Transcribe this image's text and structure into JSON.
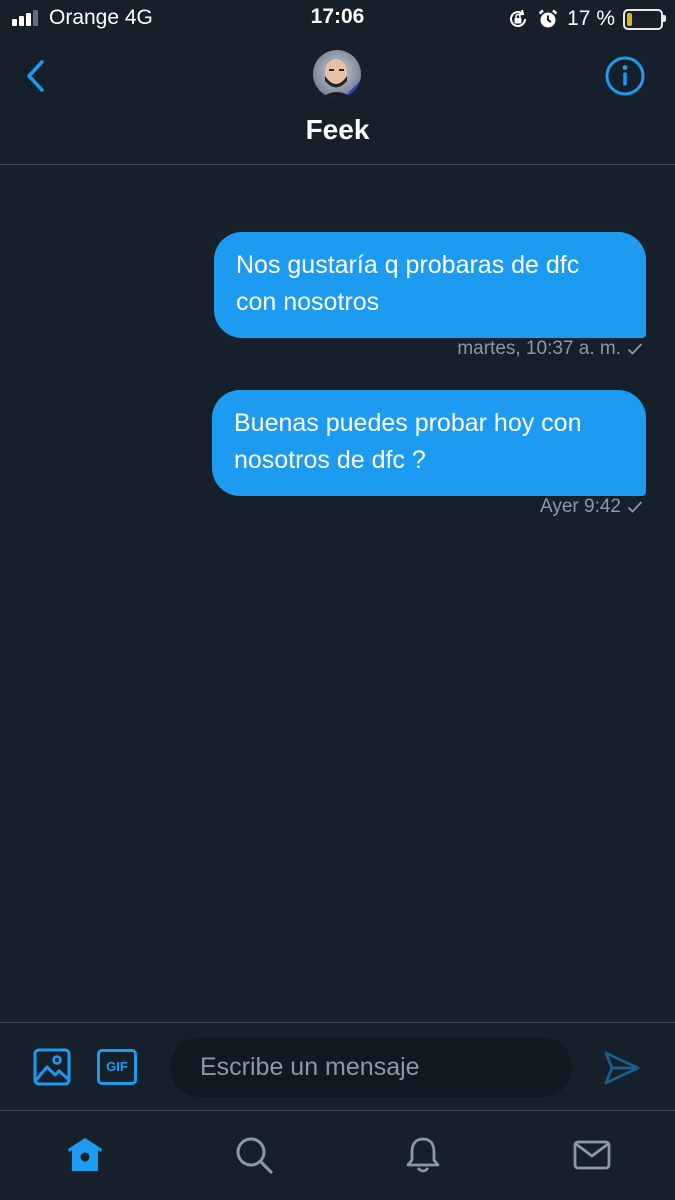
{
  "status_bar": {
    "carrier": "Orange   4G",
    "time": "17:06",
    "battery_percent": "17 %",
    "battery_level": 0.17,
    "signal_bars": 3,
    "icons": [
      "orientation-lock-icon",
      "alarm-icon",
      "battery-icon",
      "signal-icon"
    ]
  },
  "header": {
    "contact_name": "Feek",
    "icons": [
      "back-chevron-icon",
      "avatar",
      "info-icon"
    ]
  },
  "messages": [
    {
      "text": "Nos gustaría q probaras de dfc con nosotros",
      "timestamp": "martes, 10:37 a. m.",
      "status_icon": "checkmark-icon",
      "direction": "outgoing"
    },
    {
      "text": "Buenas puedes probar hoy con nosotros de dfc ?",
      "timestamp": "Ayer 9:42",
      "status_icon": "checkmark-icon",
      "direction": "outgoing"
    }
  ],
  "composer": {
    "gif_label": "GIF",
    "placeholder": "Escribe un mensaje",
    "value": "",
    "icons": [
      "image-icon",
      "gif-icon",
      "send-icon"
    ]
  },
  "tab_bar": {
    "tabs": [
      "home",
      "search",
      "notifications",
      "messages"
    ],
    "active": "home",
    "icons": [
      "home-icon",
      "search-icon",
      "bell-icon",
      "mail-icon"
    ]
  },
  "colors": {
    "background": "#15202b",
    "accent": "#1d9bf0",
    "muted_text": "#8b98a5",
    "divider": "#38444d",
    "input_background": "#101821",
    "battery_low": "#f5c518"
  }
}
